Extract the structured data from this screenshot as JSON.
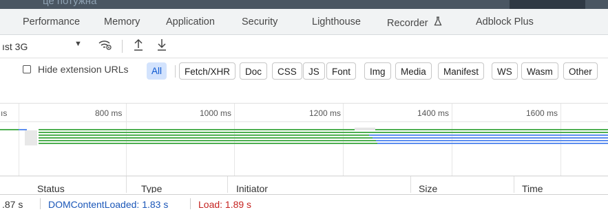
{
  "tab_bar": {
    "background_text": "це потужна",
    "tabs": [
      "Performance",
      "Memory",
      "Application",
      "Security",
      "Lighthouse",
      "Recorder",
      "Adblock Plus"
    ]
  },
  "toolbar": {
    "throttle_label": "ıst 3G",
    "icons": [
      "chevron-down-icon",
      "network-conditions-icon",
      "upload-icon",
      "download-icon"
    ]
  },
  "filter": {
    "hide_extension_label": "Hide extension URLs",
    "hide_extension_checked": false,
    "types": [
      "All",
      "Fetch/XHR",
      "Doc",
      "CSS",
      "JS",
      "Font",
      "Img",
      "Media",
      "Manifest",
      "WS",
      "Wasm",
      "Other"
    ],
    "active_type": "All"
  },
  "timeline": {
    "ticks": [
      "ıs",
      "800 ms",
      "1000 ms",
      "1200 ms",
      "1400 ms",
      "1600 ms"
    ]
  },
  "columns": [
    "Status",
    "Type",
    "Initiator",
    "Size",
    "Time"
  ],
  "status_bar": {
    "finish": ".87 s",
    "dom_content_loaded": "DOMContentLoaded: 1.83 s",
    "load": "Load: 1.89 s"
  },
  "colors": {
    "accent": "#0b57d0",
    "dom_content_loaded": "#1a56b8",
    "load": "#c5221f",
    "waterfall_green": "#4cae4f",
    "waterfall_blue": "#5b8def"
  }
}
